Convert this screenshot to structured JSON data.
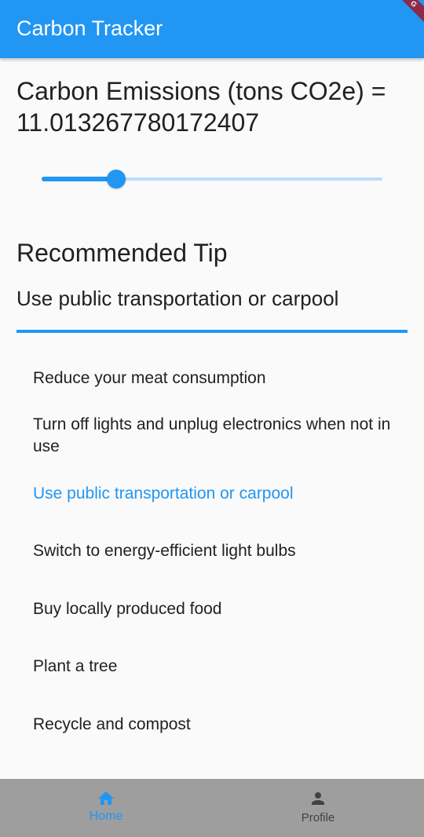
{
  "app_bar": {
    "title": "Carbon Tracker",
    "color": "#2196f3"
  },
  "debug_banner": {
    "label": "G"
  },
  "emissions": {
    "text": "Carbon Emissions (tons CO2e) = 11.013267780172407",
    "slider_fraction": 0.22
  },
  "recommended": {
    "heading": "Recommended Tip",
    "selected_tip": "Use public transportation or carpool"
  },
  "tips": [
    {
      "label": "Reduce your meat consumption",
      "selected": false
    },
    {
      "label": "Turn off lights and unplug electronics when not in use",
      "selected": false
    },
    {
      "label": "Use public transportation or carpool",
      "selected": true
    },
    {
      "label": "Switch to energy-efficient light bulbs",
      "selected": false
    },
    {
      "label": "Buy locally produced food",
      "selected": false
    },
    {
      "label": "Plant a tree",
      "selected": false
    },
    {
      "label": "Recycle and compost",
      "selected": false
    }
  ],
  "bottom_nav": {
    "items": [
      {
        "label": "Home",
        "icon": "home-icon",
        "active": true
      },
      {
        "label": "Profile",
        "icon": "person-icon",
        "active": false
      }
    ]
  }
}
